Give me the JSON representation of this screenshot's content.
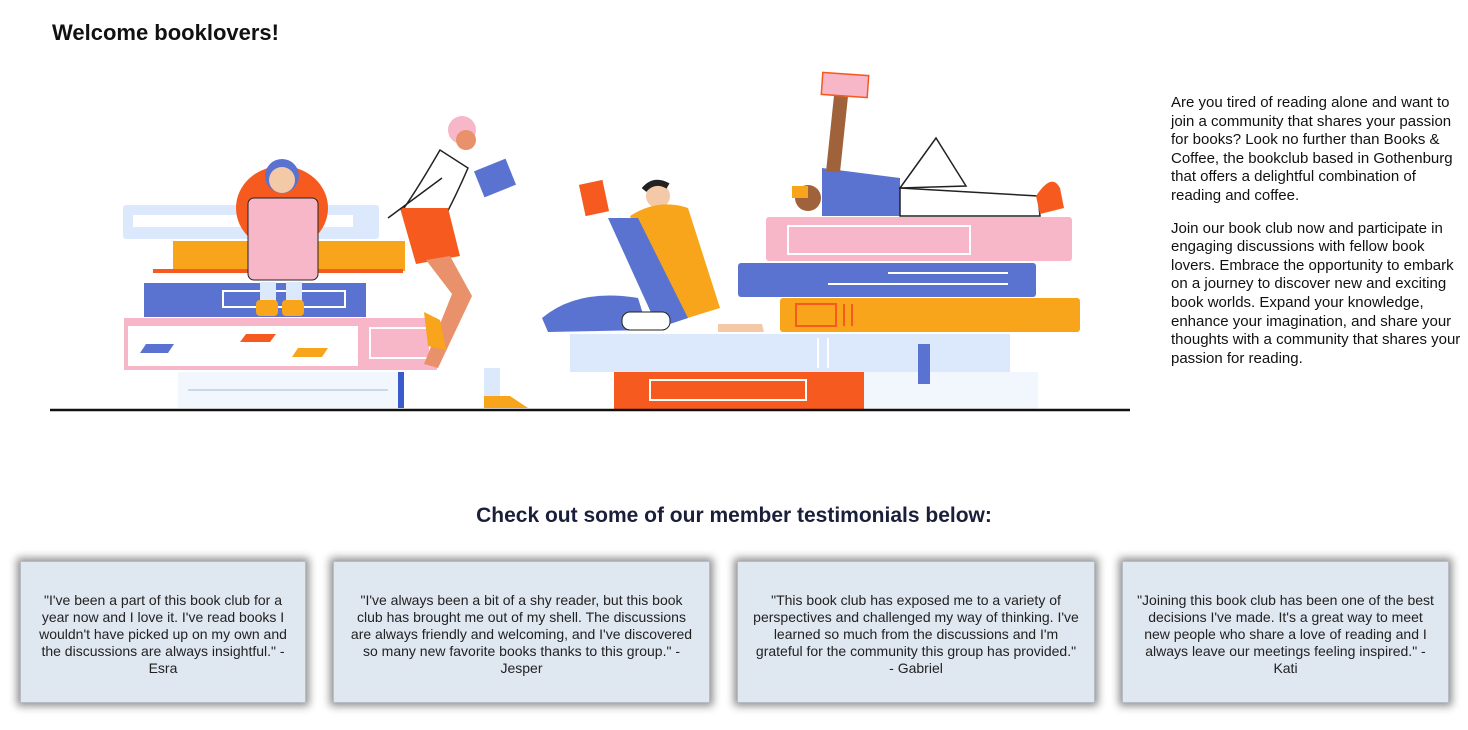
{
  "header": {
    "title": "Welcome booklovers!"
  },
  "hero": {
    "image_alt": "Illustration of people reading on stacks of books"
  },
  "intro": {
    "paragraphs": [
      "Are you tired of reading alone and want to join a community that shares your passion for books? Look no further than Books & Coffee, the bookclub based in Gothenburg that offers a delightful combination of reading and coffee.",
      "Join our book club now and participate in engaging discussions with fellow book lovers. Embrace the opportunity to embark on a journey to discover new and exciting book worlds. Expand your knowledge, enhance your imagination, and share your thoughts with a community that shares your passion for reading."
    ]
  },
  "testimonials": {
    "heading": "Check out some of our member testimonials below:",
    "items": [
      {
        "text": "\"I've been a part of this book club for a year now and I love it. I've read books I wouldn't have picked up on my own and the discussions are always insightful.\" - Esra"
      },
      {
        "text": "\"I've always been a bit of a shy reader, but this book club has brought me out of my shell. The discussions are always friendly and welcoming, and I've discovered so many new favorite books thanks to this group.\" - Jesper"
      },
      {
        "text": "\"This book club has exposed me to a variety of perspectives and challenged my way of thinking. I've learned so much from the discussions and I'm grateful for the community this group has provided.\" - Gabriel"
      },
      {
        "text": "\"Joining this book club has been one of the best decisions I've made. It's a great way to meet new people who share a love of reading and I always leave our meetings feeling inspired.\" - Kati"
      }
    ]
  },
  "colors": {
    "orange": "#f9a51c",
    "red_orange": "#f65a1f",
    "blue": "#5a73d1",
    "pink": "#f8b6c9",
    "light_blue": "#dce8fb",
    "card_bg": "#dfe7f1"
  }
}
